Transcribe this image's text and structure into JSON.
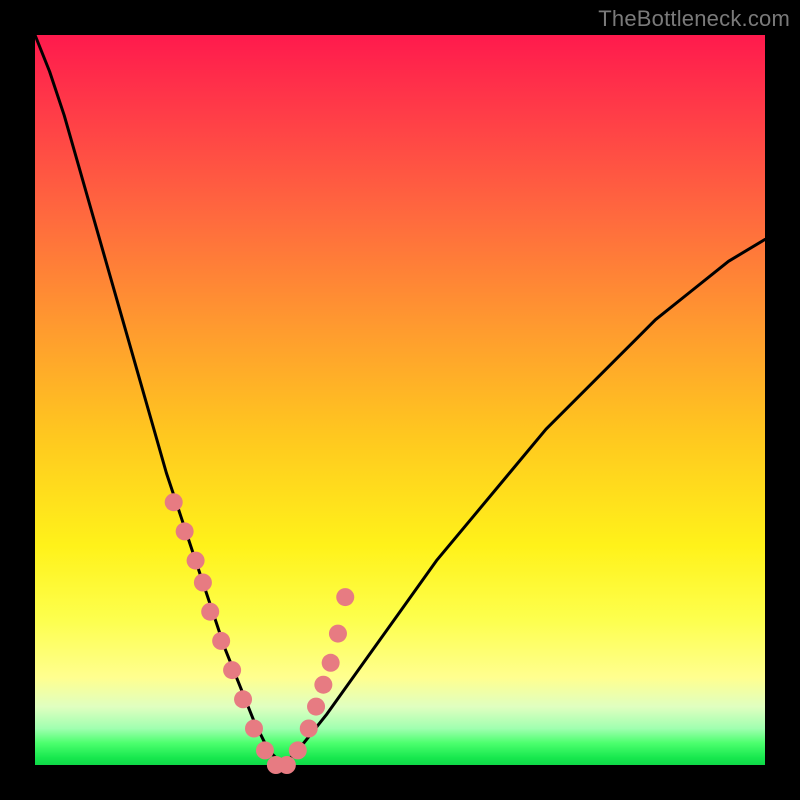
{
  "watermark": "TheBottleneck.com",
  "chart_data": {
    "type": "line",
    "title": "",
    "xlabel": "",
    "ylabel": "",
    "xlim": [
      0,
      100
    ],
    "ylim": [
      0,
      100
    ],
    "grid": false,
    "legend": false,
    "series": [
      {
        "name": "bottleneck-curve",
        "color": "#000000",
        "x": [
          0,
          2,
          4,
          6,
          8,
          10,
          12,
          14,
          16,
          18,
          20,
          22,
          24,
          26,
          28,
          30,
          32,
          34,
          36,
          40,
          45,
          50,
          55,
          60,
          65,
          70,
          75,
          80,
          85,
          90,
          95,
          100
        ],
        "y": [
          100,
          95,
          89,
          82,
          75,
          68,
          61,
          54,
          47,
          40,
          34,
          28,
          22,
          16,
          11,
          6,
          2,
          0,
          2,
          7,
          14,
          21,
          28,
          34,
          40,
          46,
          51,
          56,
          61,
          65,
          69,
          72
        ]
      }
    ],
    "markers": {
      "name": "highlighted-points",
      "color": "#e77b82",
      "radius": 9,
      "x": [
        19,
        20.5,
        22,
        23,
        24,
        25.5,
        27,
        28.5,
        30,
        31.5,
        33,
        34.5,
        36,
        37.5,
        38.5,
        39.5,
        40.5,
        41.5,
        42.5
      ],
      "y": [
        36,
        32,
        28,
        25,
        21,
        17,
        13,
        9,
        5,
        2,
        0,
        0,
        2,
        5,
        8,
        11,
        14,
        18,
        23
      ]
    }
  }
}
